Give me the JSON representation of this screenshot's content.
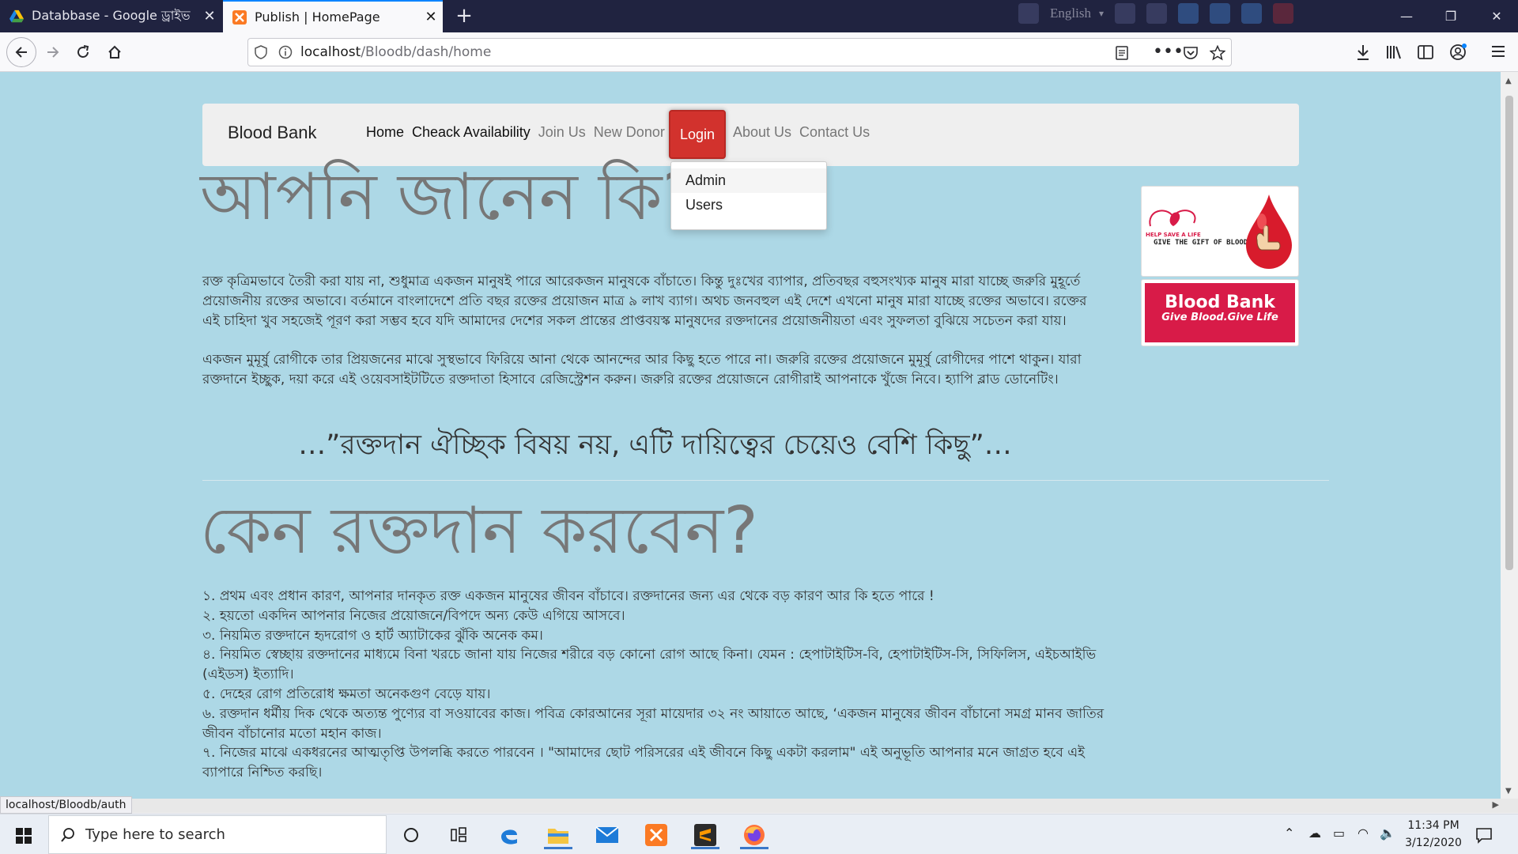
{
  "browser": {
    "tabs": [
      {
        "label": "Databbase - Google ড্রাইভ",
        "icon": "google-drive-icon",
        "active": false
      },
      {
        "label": "Publish | HomePage",
        "icon": "xampp-icon",
        "active": true
      }
    ],
    "extension_lang": "English",
    "url": {
      "host": "localhost",
      "path": "/Bloodb/dash/home"
    },
    "status_url": "localhost/Bloodb/auth"
  },
  "site": {
    "brand": "Blood Bank",
    "nav": [
      {
        "label": "Home",
        "active": true
      },
      {
        "label": "Cheack Availability",
        "active": true
      },
      {
        "label": "Join Us",
        "active": false
      },
      {
        "label": "New Donor",
        "active": false
      },
      {
        "label": "About Us",
        "active": false
      },
      {
        "label": "Contact Us",
        "active": false
      }
    ],
    "login_label": "Login",
    "login_dropdown": [
      "Admin",
      "Users"
    ],
    "heading1": "আপনি জানেন কি?",
    "paragraph1": "রক্ত কৃত্রিমভাবে তৈরী করা যায় না, শুধুমাত্র একজন মানুষই পারে আরেকজন মানুষকে বাঁচাতে। কিন্তু দুঃখের ব্যাপার, প্রতিবছর বহুসংখ্যক মানুষ মারা যাচ্ছে জরুরি মুহূর্তে প্রয়োজনীয় রক্তের অভাবে। বর্তমানে বাংলাদেশে প্রতি বছর রক্তের প্রয়োজন মাত্র ৯ লাখ ব্যাগ। অথচ জনবহুল এই দেশে এখনো মানুষ মারা যাচ্ছে রক্তের অভাবে। রক্তের এই চাহিদা খুব সহজেই পূরণ করা সম্ভব হবে যদি আমাদের দেশের সকল প্রান্তের প্রাপ্তবয়স্ক মানুষদের রক্তদানের প্রয়োজনীয়তা এবং সুফলতা বুঝিয়ে সচেতন করা যায়।",
    "paragraph2": "একজন মুমূর্ষু রোগীকে তার প্রিয়জনের মাঝে সুস্থভাবে ফিরিয়ে আনা থেকে আনন্দের আর কিছু হতে পারে না। জরুরি রক্তের প্রয়োজনে মুমূর্ষু রোগীদের পাশে থাকুন। যারা রক্তদানে ইচ্ছুক, দয়া করে এই ওয়েবসাইটটিতে রক্তদাতা হিসাবে রেজিস্ট্রেশন করুন। জরুরি রক্তের প্রয়োজনে রোগীরাই আপনাকে খুঁজে নিবে। হ্যাপি ব্লাড ডোনেটিং।",
    "quote": "…”রক্তদান ঐচ্ছিক বিষয় নয়, এটি দায়িত্বের চেয়েও বেশি কিছু”…",
    "heading2": "কেন রক্তদান করবেন?",
    "reasons": [
      "১. প্রথম এবং প্রধান কারণ, আপনার দানকৃত রক্ত একজন মানুষের জীবন বাঁচাবে। রক্তদানের জন্য এর থেকে বড় কারণ আর কি হতে পারে !",
      "২. হয়তো একদিন আপনার নিজের প্রয়োজনে/বিপদে অন্য কেউ এগিয়ে আসবে।",
      "৩. নিয়মিত রক্তদানে হৃদরোগ ও হার্ট অ্যাটাকের ঝুঁকি অনেক কম।",
      "৪. নিয়মিত স্বেচ্ছায় রক্তদানের মাধ্যমে বিনা খরচে জানা যায় নিজের শরীরে বড় কোনো রোগ আছে কিনা। যেমন : হেপাটাইটিস-বি, হেপাটাইটিস-সি, সিফিলিস, এইচআইভি (এইডস) ইত্যাদি।",
      "৫. দেহের রোগ প্রতিরোধ ক্ষমতা অনেকগুণ বেড়ে যায়।",
      "৬. রক্তদান ধর্মীয় দিক থেকে অত্যন্ত পুণ্যের বা সওয়াবের কাজ। পবিত্র কোরআনের সূরা মায়েদার ৩২ নং আয়াতে আছে, ‘একজন মানুষের জীবন বাঁচানো সমগ্র মানব জাতির জীবন বাঁচানোর মতো মহান কাজ।",
      "৭. নিজের মাঝে একধরনের আত্মতৃপ্তি উপলব্ধি করতে পারবেন । \"আমাদের ছোট পরিসরের এই জীবনে কিছু একটা করলাম\" এই অনুভূতি আপনার মনে জাগ্রত হবে এই ব্যাপারে নিশ্চিত করছি।"
    ],
    "ad1": {
      "line1": "HELP SAVE A LIFE",
      "line2": "GIVE THE GIFT OF BLOOD"
    },
    "ad2": {
      "title": "Blood Bank",
      "subtitle": "Give Blood.Give Life"
    }
  },
  "taskbar": {
    "search_placeholder": "Type here to search",
    "time": "11:34 PM",
    "date": "3/12/2020"
  },
  "colors": {
    "page_bg": "#add8e6",
    "login_red": "#d2322d",
    "ad_red": "#d81b48"
  }
}
